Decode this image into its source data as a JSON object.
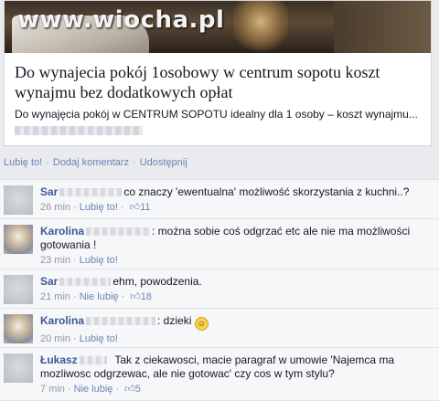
{
  "preview": {
    "watermark": "www.wiocha.pl",
    "title": "Do wynajecia pokój 1osobowy w centrum sopotu koszt wynajmu bez dodatkowych opłat",
    "description": "Do wynajęcia pokój w CENTRUM SOPOTU idealny dla 1 osoby – koszt wynajmu..."
  },
  "actions": {
    "like": "Lubię to!",
    "comment": "Dodaj komentarz",
    "share": "Udostępnij",
    "separator": "·"
  },
  "icons": {
    "like": "thumbs-up-icon",
    "smiley": "smiley-icon"
  },
  "comments": [
    {
      "author": "Sar",
      "text": "co znaczy 'ewentualna' możliwość skorzystania z kuchni..?",
      "time": "26 min",
      "like_label": "Lubię to!",
      "likes": "11"
    },
    {
      "author": "Karolina",
      "text": ": można sobie coś odgrzać etc ale nie ma możliwości gotowania !",
      "time": "23 min",
      "like_label": "Lubię to!",
      "likes": ""
    },
    {
      "author": "Sar",
      "text": "ehm, powodzenia.",
      "time": "21 min",
      "like_label": "Nie lubię",
      "likes": "18"
    },
    {
      "author": "Karolina",
      "text": ": dzieki",
      "time": "20 min",
      "like_label": "Lubię to!",
      "likes": ""
    },
    {
      "author": "Łukasz",
      "text": "Tak z ciekawosci, macie paragraf w umowie 'Najemca ma mozliwosc odgrzewac, ale nie gotowac' czy cos w tym stylu?",
      "time": "7 min",
      "like_label": "Nie lubię",
      "likes": "5"
    }
  ]
}
